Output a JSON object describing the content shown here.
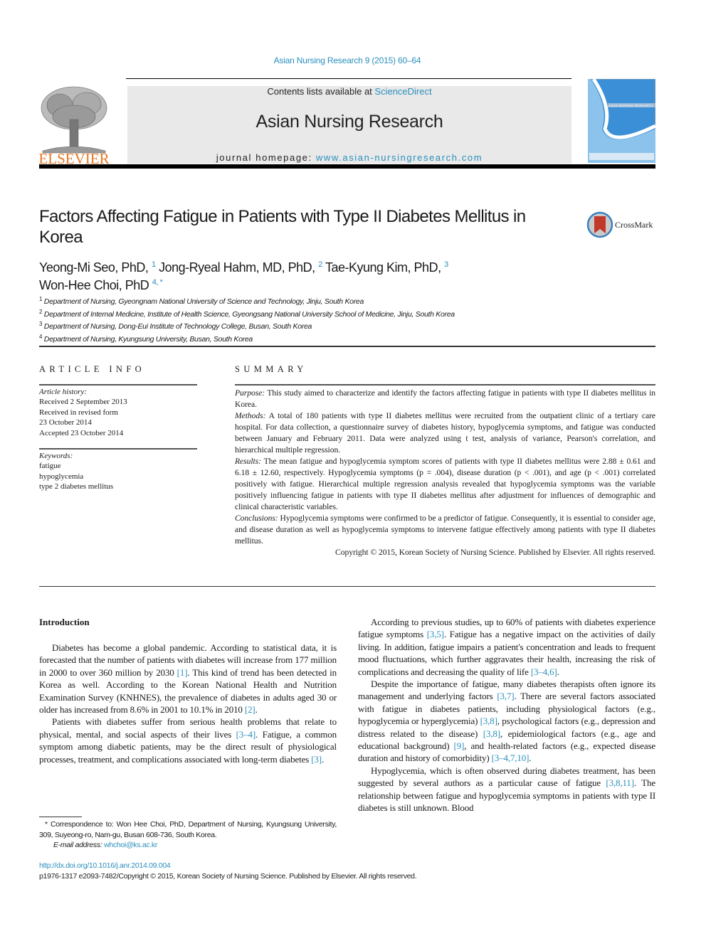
{
  "header": {
    "citation": "Asian Nursing Research 9 (2015) 60–64",
    "contents_prefix": "Contents lists available at ",
    "contents_link": "ScienceDirect",
    "journal_name": "Asian Nursing Research",
    "homepage_prefix": "journal homepage: ",
    "homepage_link": "www.asian-nursingresearch.com",
    "publisher_logo": "ELSEVIER",
    "cover_title": "ASIAN NURSING RESEARCH"
  },
  "article": {
    "title": "Factors Affecting Fatigue in Patients with Type II Diabetes Mellitus in Korea",
    "crossmark_label": "CrossMark",
    "authors": [
      {
        "name": "Yeong-Mi Seo, PhD,",
        "sup": "1"
      },
      {
        "name": "Jong-Ryeal Hahm, MD, PhD,",
        "sup": "2"
      },
      {
        "name": "Tae-Kyung Kim, PhD,",
        "sup": "3"
      },
      {
        "name": "Won-Hee Choi, PhD",
        "sup": "4, *"
      }
    ],
    "affiliations": [
      {
        "num": "1",
        "text": "Department of Nursing, Gyeongnam National University of Science and Technology, Jinju, South Korea"
      },
      {
        "num": "2",
        "text": "Department of Internal Medicine, Institute of Health Science, Gyeongsang National University School of Medicine, Jinju, South Korea"
      },
      {
        "num": "3",
        "text": "Department of Nursing, Dong-Eui Institute of Technology College, Busan, South Korea"
      },
      {
        "num": "4",
        "text": "Department of Nursing, Kyungsung University, Busan, South Korea"
      }
    ]
  },
  "article_info": {
    "heading": "ARTICLE INFO",
    "history_label": "Article history:",
    "history": [
      "Received 2 September 2013",
      "Received in revised form",
      "23 October 2014",
      "Accepted 23 October 2014"
    ],
    "keywords_label": "Keywords:",
    "keywords": [
      "fatigue",
      "hypoglycemia",
      "type 2 diabetes mellitus"
    ]
  },
  "summary": {
    "heading": "SUMMARY",
    "purpose_label": "Purpose:",
    "purpose": " This study aimed to characterize and identify the factors affecting fatigue in patients with type II diabetes mellitus in Korea.",
    "methods_label": "Methods:",
    "methods": " A total of 180 patients with type II diabetes mellitus were recruited from the outpatient clinic of a tertiary care hospital. For data collection, a questionnaire survey of diabetes history, hypoglycemia symptoms, and fatigue was conducted between January and February 2011. Data were analyzed using t test, analysis of variance, Pearson's correlation, and hierarchical multiple regression.",
    "results_label": "Results:",
    "results": " The mean fatigue and hypoglycemia symptom scores of patients with type II diabetes mellitus were 2.88 ± 0.61 and 6.18 ± 12.60, respectively. Hypoglycemia symptoms (p = .004), disease duration (p < .001), and age (p < .001) correlated positively with fatigue. Hierarchical multiple regression analysis revealed that hypoglycemia symptoms was the variable positively influencing fatigue in patients with type II diabetes mellitus after adjustment for influences of demographic and clinical characteristic variables.",
    "conclusions_label": "Conclusions:",
    "conclusions": " Hypoglycemia symptoms were confirmed to be a predictor of fatigue. Consequently, it is essential to consider age, and disease duration as well as hypoglycemia symptoms to intervene fatigue effectively among patients with type II diabetes mellitus.",
    "copyright": "Copyright © 2015, Korean Society of Nursing Science. Published by Elsevier. All rights reserved."
  },
  "body": {
    "intro_heading": "Introduction",
    "left": [
      [
        "Diabetes has become a global pandemic. According to statistical data, it is forecasted that the number of patients with diabetes will increase from 177 million in 2000 to over 360 million by 2030 ",
        "[1]",
        ". This kind of trend has been detected in Korea as well. According to the Korean National Health and Nutrition Examination Survey (KNHNES), the prevalence of diabetes in adults aged 30 or older has increased from 8.6% in 2001 to 10.1% in 2010 ",
        "[2]",
        "."
      ],
      [
        "Patients with diabetes suffer from serious health problems that relate to physical, mental, and social aspects of their lives ",
        "[3–4]",
        ". Fatigue, a common symptom among diabetic patients, may be the direct result of physiological processes, treatment, and complications associated with long-term diabetes ",
        "[3]",
        "."
      ]
    ],
    "right": [
      [
        "According to previous studies, up to 60% of patients with diabetes experience fatigue symptoms ",
        "[3,5]",
        ". Fatigue has a negative impact on the activities of daily living. In addition, fatigue impairs a patient's concentration and leads to frequent mood fluctuations, which further aggravates their health, increasing the risk of complications and decreasing the quality of life ",
        "[3–4,6]",
        "."
      ],
      [
        "Despite the importance of fatigue, many diabetes therapists often ignore its management and underlying factors ",
        "[3,7]",
        ". There are several factors associated with fatigue in diabetes patients, including physiological factors (e.g., hypoglycemia or hyperglycemia) ",
        "[3,8]",
        ", psychological factors (e.g., depression and distress related to the disease) ",
        "[3,8]",
        ", epidemiological factors (e.g., age and educational background) ",
        "[9]",
        ", and health-related factors (e.g., expected disease duration and history of comorbidity) ",
        "[3–4,7,10]",
        "."
      ],
      [
        "Hypoglycemia, which is often observed during diabetes treatment, has been suggested by several authors as a particular cause of fatigue ",
        "[3,8,11]",
        ". The relationship between fatigue and hypoglycemia symptoms in patients with type II diabetes is still unknown. Blood"
      ]
    ]
  },
  "footnote": {
    "correspondence": "* Correspondence to: Won Hee Choi, PhD, Department of Nursing, Kyungsung University, 309, Suyeong-ro, Nam-gu, Busan 608-736, South Korea.",
    "email_label": "E-mail address: ",
    "email": "whchoi@ks.ac.kr",
    "doi": "http://dx.doi.org/10.1016/j.anr.2014.09.004",
    "issn": "p1976-1317 e2093-7482/Copyright © 2015, Korean Society of Nursing Science. Published by Elsevier. All rights reserved."
  }
}
